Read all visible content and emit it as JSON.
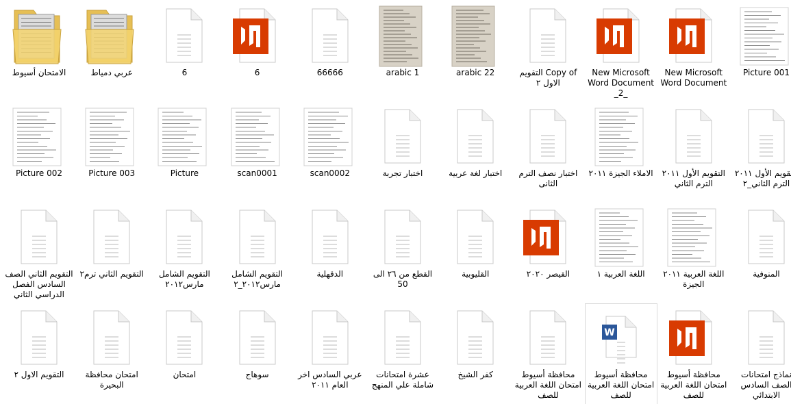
{
  "view": "large-icons",
  "icons": {
    "folder": "folder-icon",
    "doc": "blank-document-icon",
    "pdf": "pdf-reader-icon",
    "scan": "scanned-page-thumbnail",
    "photo": "photo-thumbnail",
    "word": "word-document-icon"
  },
  "colors": {
    "pdf_red": "#d83b01",
    "folder_yellow": "#f3d36e",
    "word_blue": "#2b579a"
  },
  "items": [
    {
      "label": "الامتحان أسيوط",
      "type": "folder"
    },
    {
      "label": "عربي دمياط",
      "type": "folder"
    },
    {
      "label": "6",
      "type": "doc"
    },
    {
      "label": "6",
      "type": "pdf"
    },
    {
      "label": "66666",
      "type": "doc"
    },
    {
      "label": "arabic 1",
      "type": "photo"
    },
    {
      "label": "arabic 22",
      "type": "photo"
    },
    {
      "label": "Copy of التقويم الاول ٢",
      "type": "doc"
    },
    {
      "label": "New Microsoft Word Document _2_",
      "type": "pdf"
    },
    {
      "label": "New Microsoft Word Document",
      "type": "pdf"
    },
    {
      "label": "Picture 001",
      "type": "scan"
    },
    {
      "label": "Picture 002",
      "type": "scan"
    },
    {
      "label": "Picture 003",
      "type": "scan"
    },
    {
      "label": "Picture",
      "type": "scan"
    },
    {
      "label": "scan0001",
      "type": "scan"
    },
    {
      "label": "scan0002",
      "type": "scan"
    },
    {
      "label": "اختبار تجربة",
      "type": "doc"
    },
    {
      "label": "اختبار لغة عربية",
      "type": "doc"
    },
    {
      "label": "اختبار نصف الترم الثانى",
      "type": "doc"
    },
    {
      "label": "الاملاء الجيزة ٢٠١١",
      "type": "scan"
    },
    {
      "label": "التقويم الأول ٢٠١١ الترم الثاني",
      "type": "doc"
    },
    {
      "label": "التقويم الأول ٢٠١١ الترم الثاني_٢",
      "type": "doc"
    },
    {
      "label": "التقويم الثاني الصف السادس الفصل الدراسي الثاني",
      "type": "doc"
    },
    {
      "label": "التقويم الثاني ترم٢",
      "type": "doc"
    },
    {
      "label": "التقويم الشامل مارس٢٠١٢",
      "type": "doc"
    },
    {
      "label": "التقويم الشامل مارس٢٠١٢_٢",
      "type": "doc"
    },
    {
      "label": "الدقهلية",
      "type": "doc"
    },
    {
      "label": "القطع من ٢٦ الى 50",
      "type": "doc"
    },
    {
      "label": "القليوبية",
      "type": "doc"
    },
    {
      "label": "القيصر ٢٠٢٠",
      "type": "pdf"
    },
    {
      "label": "اللغة العربية ١",
      "type": "scan"
    },
    {
      "label": "اللغة العربية ٢٠١١ الجيزة",
      "type": "scan"
    },
    {
      "label": "المنوفية",
      "type": "doc"
    },
    {
      "label": "التقويم الاول ٢",
      "type": "doc"
    },
    {
      "label": "امتحان محافظة البحيرة",
      "type": "doc"
    },
    {
      "label": "امتحان",
      "type": "doc"
    },
    {
      "label": "سوهاج",
      "type": "doc"
    },
    {
      "label": "عربي السادس اخر العام ٢٠١١",
      "type": "doc"
    },
    {
      "label": "عشرة امتحانات شاملة علي المنهج",
      "type": "doc"
    },
    {
      "label": "كفر الشيخ",
      "type": "doc"
    },
    {
      "label": "محافظة أسيوط امتحان اللغة العربية للصف",
      "type": "doc"
    },
    {
      "label": "محافظة أسيوط امتحان اللغة العربية للصف",
      "type": "word"
    },
    {
      "label": "محافظة أسيوط امتحان اللغة العربية للصف",
      "type": "pdf"
    },
    {
      "label": "نماذج امتحانات الصف السادس الابتدائي",
      "type": "doc"
    }
  ]
}
